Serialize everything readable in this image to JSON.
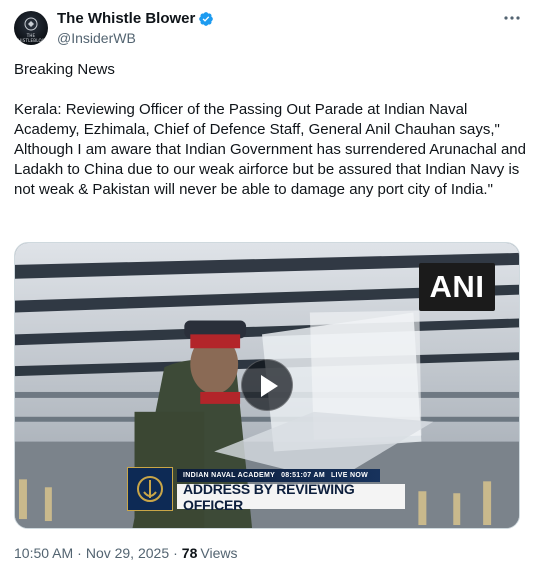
{
  "author": {
    "display_name": "The Whistle Blower",
    "handle": "@InsiderWB",
    "avatar_text": "THE WHISTLEBLOWER",
    "verified": true
  },
  "tweet": {
    "headline": "Breaking News",
    "body": "Kerala: Reviewing Officer of the Passing Out Parade at Indian Naval Academy, Ezhimala, Chief of Defence Staff, General Anil Chauhan says,\" Although I am aware that Indian Government has surrendered Arunachal and Ladakh to China due to our weak airforce but be assured that Indian Navy is not weak & Pakistan will never be able to damage any port city of India.\""
  },
  "media": {
    "watermark": "ANI",
    "lower_third_top": [
      "INDIAN NAVAL ACADEMY",
      "08:51:07 AM",
      "LIVE NOW"
    ],
    "lower_third_main": "ADDRESS BY REVIEWING OFFICER"
  },
  "meta": {
    "time": "10:50 AM",
    "separator": "·",
    "date": "Nov 29, 2025",
    "views_count": "78",
    "views_label": "Views"
  },
  "colors": {
    "verified_blue": "#1d9bf0",
    "text_primary": "#0f1419",
    "text_secondary": "#536471"
  },
  "icons": [
    "verified-badge-icon",
    "more-options-icon",
    "play-icon"
  ]
}
